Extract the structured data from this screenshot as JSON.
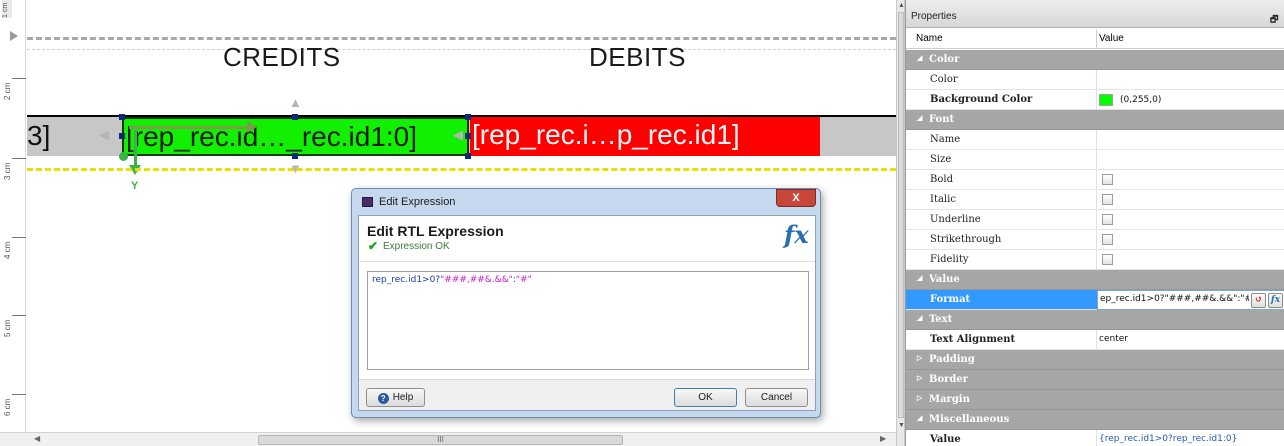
{
  "ruler": {
    "top_label": "1 cm",
    "labels": [
      "2 cm",
      "3 cm",
      "4 cm",
      "5 cm",
      "6 cm"
    ]
  },
  "report": {
    "header_credits": "CREDITS",
    "header_debits": "DEBITS",
    "row_left_fragment": "3]",
    "green_cell_text": "[rep_rec.id…_rec.id1:0]",
    "red_cell_text": "[rep_rec.i…p_rec.id1]",
    "axis_y_label": "Y",
    "green_color": "#10f000",
    "red_color": "#ff0000"
  },
  "scrollbar": {
    "thumb_grip": "III"
  },
  "dialog": {
    "title": "Edit Expression",
    "close_label": "X",
    "heading": "Edit RTL Expression",
    "status": "Expression OK",
    "fx_icon": "fx",
    "expression": {
      "part1": "rep_rec.id1",
      "part2": ">0?",
      "part3": "\"###,##&.&&\"",
      "part4": ":",
      "part5": "\"#\""
    },
    "help_label": "Help",
    "ok_label": "OK",
    "cancel_label": "Cancel"
  },
  "properties": {
    "title": "Properties",
    "col_name": "Name",
    "col_value": "Value",
    "categories": {
      "color": "Color",
      "font": "Font",
      "value": "Value",
      "text": "Text",
      "padding": "Padding",
      "border": "Border",
      "margin": "Margin",
      "misc": "Miscellaneous"
    },
    "rows": {
      "color": "Color",
      "background_color": "Background Color",
      "background_color_value": "(0,255,0)",
      "font_name": "Name",
      "size": "Size",
      "bold": "Bold",
      "italic": "Italic",
      "underline": "Underline",
      "strikethrough": "Strikethrough",
      "fidelity": "Fidelity",
      "format": "Format",
      "format_value": "ep_rec.id1>0?\"###,##&.&&\":\"#\"",
      "text_alignment": "Text Alignment",
      "text_alignment_value": "center",
      "value": "Value",
      "value_value": "{rep_rec.id1>0?rep_rec.id1:0}"
    },
    "selected_row_color": "#3399ff",
    "swatch_color": "#00ff00"
  }
}
